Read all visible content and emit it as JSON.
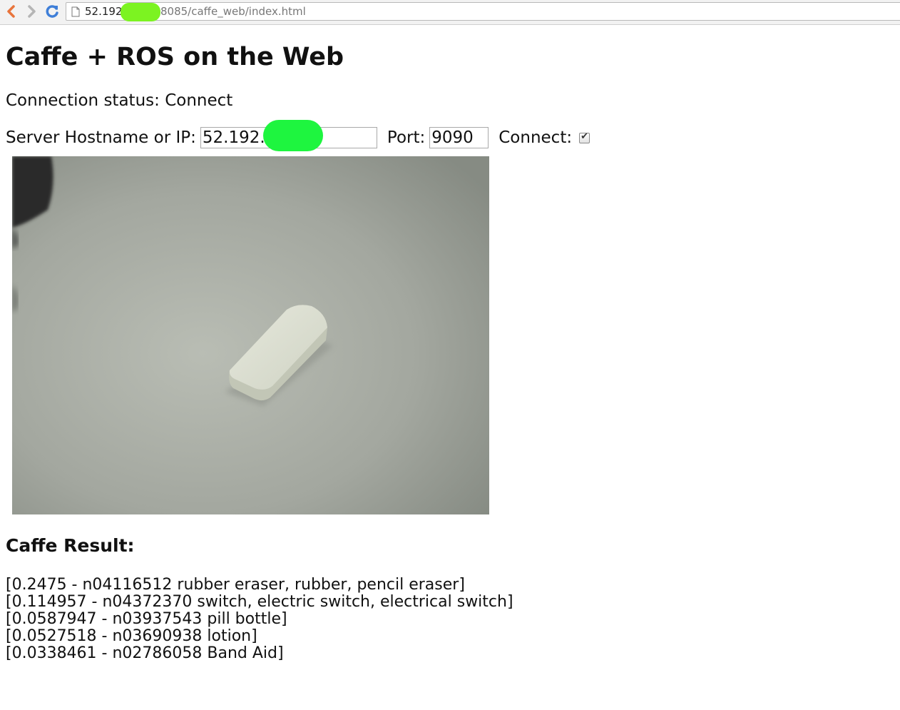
{
  "browser": {
    "url_host": "52.192",
    "url_path": "8085/caffe_web/index.html"
  },
  "page": {
    "title": "Caffe + ROS on the Web",
    "connection_status_label": "Connection status:",
    "connection_status_value": "Connect",
    "server_label": "Server Hostname or IP:",
    "server_value": "52.192.",
    "port_label": "Port:",
    "port_value": "9090",
    "connect_label": "Connect:",
    "connect_checked": true
  },
  "results": {
    "title": "Caffe Result:",
    "items": [
      "[0.2475 - n04116512 rubber eraser, rubber, pencil eraser]",
      "[0.114957 - n04372370 switch, electric switch, electrical switch]",
      "[0.0587947 - n03937543 pill bottle]",
      "[0.0527518 - n03690938 lotion]",
      "[0.0338461 - n02786058 Band Aid]"
    ]
  },
  "icons": [
    "back-icon",
    "forward-icon",
    "reload-icon",
    "page-icon"
  ]
}
